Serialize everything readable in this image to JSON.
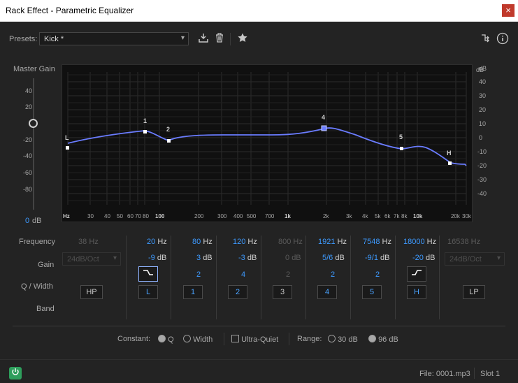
{
  "window": {
    "title": "Rack Effect - Parametric Equalizer",
    "close_label": "×"
  },
  "presets": {
    "label": "Presets:",
    "value": "Kick *"
  },
  "icons": {
    "save": "download-icon",
    "delete": "trash-icon",
    "favorite": "star-icon",
    "routing": "routing-icon",
    "info": "info-icon",
    "chevron": "▾"
  },
  "master_gain": {
    "label": "Master Gain",
    "ticks": [
      "40",
      "20",
      "0",
      "-20",
      "-40",
      "-60",
      "-80"
    ],
    "value": "0",
    "unit": "dB"
  },
  "graph": {
    "db_unit": "dB",
    "db_ticks": [
      "40",
      "30",
      "20",
      "10",
      "0",
      "-10",
      "-20",
      "-30",
      "-40"
    ],
    "hz_labels": [
      "Hz",
      "30",
      "40",
      "50",
      "60",
      "70",
      "80",
      "100",
      "200",
      "300",
      "400",
      "500",
      "700",
      "1k",
      "2k",
      "3k",
      "4k",
      "5k",
      "6k",
      "7k",
      "8k",
      "10k",
      "20k",
      "30k"
    ],
    "band_markers": [
      "L",
      "1",
      "2",
      "4",
      "5",
      "H"
    ]
  },
  "row_labels": {
    "frequency": "Frequency",
    "gain": "Gain",
    "qwidth": "Q / Width",
    "band": "Band"
  },
  "bands": {
    "hp": {
      "freq_value": "38",
      "freq_unit": "Hz",
      "slope": "24dB/Oct",
      "button": "HP"
    },
    "l": {
      "freq_value": "20",
      "freq_unit": "Hz",
      "gain_value": "-9",
      "gain_unit": "dB",
      "button": "L"
    },
    "b1": {
      "freq_value": "80",
      "freq_unit": "Hz",
      "gain_value": "3",
      "gain_unit": "dB",
      "q": "2",
      "button": "1"
    },
    "b2": {
      "freq_value": "120",
      "freq_unit": "Hz",
      "gain_value": "-3",
      "gain_unit": "dB",
      "q": "4",
      "button": "2"
    },
    "b3": {
      "freq_value": "800",
      "freq_unit": "Hz",
      "gain_value": "0",
      "gain_unit": "dB",
      "q": "2",
      "button": "3"
    },
    "b4": {
      "freq_value": "1921",
      "freq_unit": "Hz",
      "gain_value": "5/6",
      "gain_unit": "dB",
      "q": "2",
      "button": "4"
    },
    "b5": {
      "freq_value": "7548",
      "freq_unit": "Hz",
      "gain_value": "-9/1",
      "gain_unit": "dB",
      "q": "2",
      "button": "5"
    },
    "h": {
      "freq_value": "18000",
      "freq_unit": "Hz",
      "gain_value": "-20",
      "gain_unit": "dB",
      "button": "H"
    },
    "lp": {
      "freq_value": "16538",
      "freq_unit": "Hz",
      "slope": "24dB/Oct",
      "button": "LP"
    }
  },
  "options": {
    "constant_label": "Constant:",
    "q_label": "Q",
    "width_label": "Width",
    "ultra_quiet_label": "Ultra-Quiet",
    "range_label": "Range:",
    "range_30": "30 dB",
    "range_96": "96 dB"
  },
  "status": {
    "file": "File: 0001.mp3",
    "slot": "Slot 1"
  }
}
